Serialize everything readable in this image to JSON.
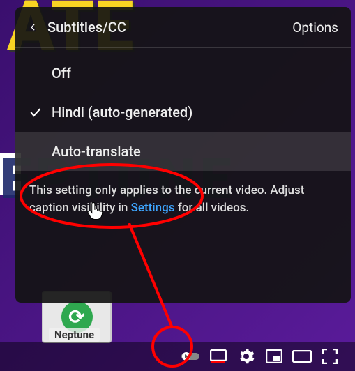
{
  "bg": {
    "word1": "ATE",
    "word2": "EPTUNE",
    "thumb_label": "Neptune"
  },
  "panel": {
    "title": "Subtitles/CC",
    "options_label": "Options",
    "items": [
      {
        "label": "Off",
        "selected": false
      },
      {
        "label": "Hindi (auto-generated)",
        "selected": true
      },
      {
        "label": "Auto-translate",
        "selected": false,
        "hover": true
      }
    ],
    "note_pre": "This setting only applies to the current video. Adjust caption visibility in ",
    "note_link": "Settings",
    "note_post": " for all videos."
  },
  "colors": {
    "accent": "#ff0000"
  }
}
